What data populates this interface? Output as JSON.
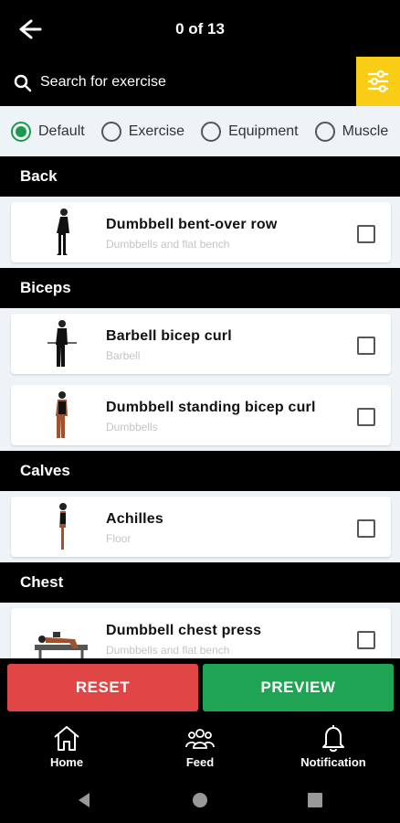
{
  "header": {
    "counter": "0 of 13"
  },
  "search": {
    "placeholder": "Search for exercise"
  },
  "sort_options": [
    {
      "label": "Default",
      "selected": true
    },
    {
      "label": "Exercise",
      "selected": false
    },
    {
      "label": "Equipment",
      "selected": false
    },
    {
      "label": "Muscle",
      "selected": false
    }
  ],
  "sections": [
    {
      "title": "Back",
      "items": [
        {
          "name": "Dumbbell bent-over row",
          "equipment": "Dumbbells and flat bench",
          "checked": false
        }
      ]
    },
    {
      "title": "Biceps",
      "items": [
        {
          "name": "Barbell bicep curl",
          "equipment": "Barbell",
          "checked": false
        },
        {
          "name": "Dumbbell standing bicep curl",
          "equipment": "Dumbbells",
          "checked": false
        }
      ]
    },
    {
      "title": "Calves",
      "items": [
        {
          "name": "Achilles",
          "equipment": "Floor",
          "checked": false
        }
      ]
    },
    {
      "title": "Chest",
      "items": [
        {
          "name": "Dumbbell chest press",
          "equipment": "Dumbbells and flat bench",
          "checked": false
        }
      ]
    }
  ],
  "actions": {
    "reset": "RESET",
    "preview": "PREVIEW"
  },
  "bottom_nav": [
    {
      "label": "Home",
      "icon": "home-icon"
    },
    {
      "label": "Feed",
      "icon": "feed-icon"
    },
    {
      "label": "Notification",
      "icon": "bell-icon"
    }
  ],
  "colors": {
    "accent_yellow": "#f9cc15",
    "reset_red": "#e04646",
    "preview_green": "#1fa454",
    "radio_green": "#1b9a4e"
  }
}
